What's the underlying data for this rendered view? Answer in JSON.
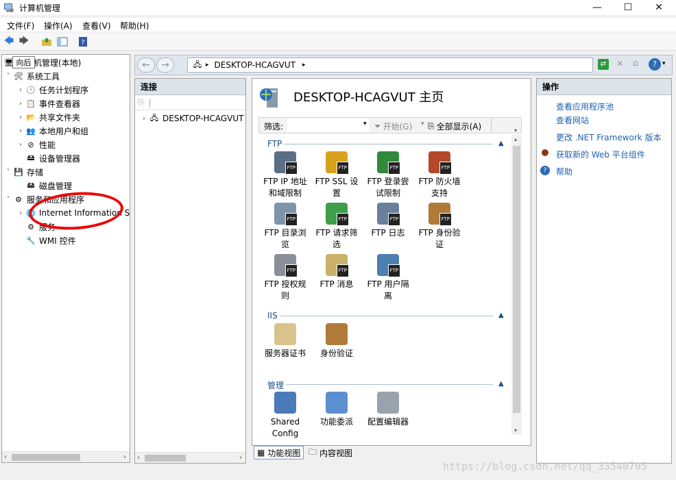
{
  "window": {
    "title": "计算机管理",
    "controls": [
      "—",
      "☐",
      "✕"
    ]
  },
  "menu": [
    "文件(F)",
    "操作(A)",
    "查看(V)",
    "帮助(H)"
  ],
  "tooltip": "向后",
  "tree": {
    "root": "计算机管理(本地)",
    "items": [
      {
        "label": "系统工具",
        "level": 0,
        "chev": "˅"
      },
      {
        "label": "任务计划程序",
        "level": 1,
        "chev": "›"
      },
      {
        "label": "事件查看器",
        "level": 1,
        "chev": "›"
      },
      {
        "label": "共享文件夹",
        "level": 1,
        "chev": "›"
      },
      {
        "label": "本地用户和组",
        "level": 1,
        "chev": "›"
      },
      {
        "label": "性能",
        "level": 1,
        "chev": "›"
      },
      {
        "label": "设备管理器",
        "level": 1,
        "chev": ""
      },
      {
        "label": "存储",
        "level": 0,
        "chev": "˅"
      },
      {
        "label": "磁盘管理",
        "level": 1,
        "chev": ""
      },
      {
        "label": "服务和应用程序",
        "level": 0,
        "chev": "˅"
      },
      {
        "label": "Internet Information S",
        "level": 1,
        "chev": "›"
      },
      {
        "label": "服务",
        "level": 1,
        "chev": ""
      },
      {
        "label": "WMI 控件",
        "level": 1,
        "chev": ""
      }
    ]
  },
  "iis": {
    "address": "DESKTOP-HCAGVUT",
    "connections": {
      "header": "连接",
      "node": "DESKTOP-HCAGVUT"
    },
    "main_title": "DESKTOP-HCAGVUT 主页",
    "filter": {
      "label": "筛选:",
      "go": "开始(G)",
      "show_all": "全部显示(A)"
    },
    "groups": [
      {
        "name": "FTP"
      },
      {
        "name": "IIS"
      },
      {
        "name": "管理"
      }
    ],
    "features": [
      {
        "l1": "FTP IP 地址",
        "l2": "和域限制",
        "icon": "ip-restriction-icon",
        "ftp": true
      },
      {
        "l1": "FTP SSL 设",
        "l2": "置",
        "icon": "ssl-lock-icon",
        "ftp": true
      },
      {
        "l1": "FTP 登录尝",
        "l2": "试限制",
        "icon": "globe-icon",
        "ftp": true
      },
      {
        "l1": "FTP 防火墙",
        "l2": "支持",
        "icon": "firewall-icon",
        "ftp": true
      },
      {
        "l1": "FTP 目录浏",
        "l2": "览",
        "icon": "directory-browse-icon",
        "ftp": true
      },
      {
        "l1": "FTP 请求筛",
        "l2": "选",
        "icon": "request-filter-icon",
        "ftp": true
      },
      {
        "l1": "FTP 日志",
        "l2": "",
        "icon": "log-icon",
        "ftp": true
      },
      {
        "l1": "FTP 身份验",
        "l2": "证",
        "icon": "auth-user-icon",
        "ftp": true
      },
      {
        "l1": "FTP 授权规",
        "l2": "则",
        "icon": "key-icon",
        "ftp": true
      },
      {
        "l1": "FTP 消息",
        "l2": "",
        "icon": "message-icon",
        "ftp": true
      },
      {
        "l1": "FTP 用户隔",
        "l2": "离",
        "icon": "user-isolation-icon",
        "ftp": true
      },
      {
        "l1": "服务器证书",
        "l2": "",
        "icon": "certificate-icon",
        "ftp": false
      },
      {
        "l1": "身份验证",
        "l2": "",
        "icon": "auth-user-icon",
        "ftp": false
      },
      {
        "l1": "Shared",
        "l2": "Config",
        "icon": "shared-config-icon",
        "ftp": false
      },
      {
        "l1": "功能委派",
        "l2": "",
        "icon": "delegation-icon",
        "ftp": false
      },
      {
        "l1": "配置编辑器",
        "l2": "",
        "icon": "config-editor-icon",
        "ftp": false
      }
    ],
    "view_tabs": [
      "功能视图",
      "内容视图"
    ],
    "actions": {
      "header": "操作",
      "links": [
        "查看应用程序池",
        "查看网站",
        "更改 .NET Framework 版本",
        "获取新的 Web 平台组件",
        "帮助"
      ]
    }
  },
  "watermark": "https://blog.csdn.net/qq_33540705",
  "colors": {
    "link": "#1e62b0",
    "group": "#1c4b8c",
    "annotation": "#e00000"
  }
}
